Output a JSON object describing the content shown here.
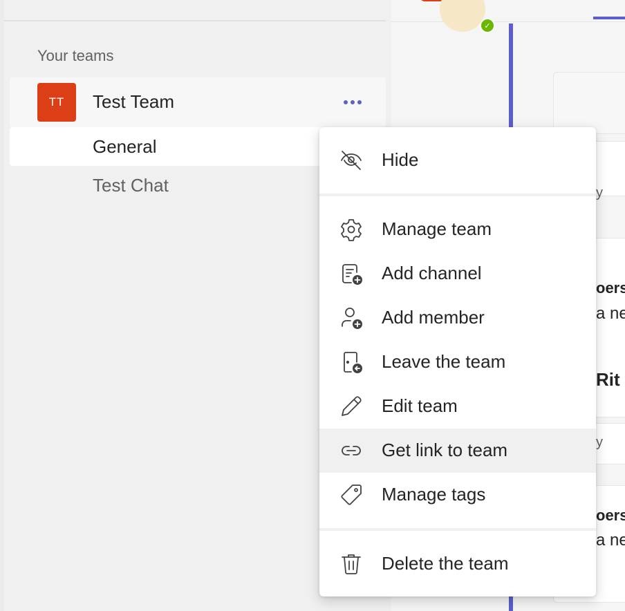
{
  "sidebar": {
    "section_label": "Your teams",
    "team": {
      "initials": "TT",
      "name": "Test Team",
      "avatar_color": "#dc3e15",
      "more_icon": "more-options-icon"
    },
    "channels": [
      {
        "label": "General",
        "selected": true
      },
      {
        "label": "Test Chat",
        "selected": false
      }
    ]
  },
  "main": {
    "peek_texts": [
      "oers",
      "a ne",
      "Rit",
      "oers",
      "a ne",
      "y",
      "y"
    ]
  },
  "menu": {
    "items": [
      {
        "label": "Hide",
        "icon": "eye-off-icon"
      },
      {
        "label": "Manage team",
        "icon": "gear-icon"
      },
      {
        "label": "Add channel",
        "icon": "add-channel-icon"
      },
      {
        "label": "Add member",
        "icon": "add-person-icon"
      },
      {
        "label": "Leave the team",
        "icon": "leave-door-icon"
      },
      {
        "label": "Edit team",
        "icon": "pencil-icon"
      },
      {
        "label": "Get link to team",
        "icon": "link-icon",
        "hovered": true
      },
      {
        "label": "Manage tags",
        "icon": "tag-icon"
      },
      {
        "label": "Delete the team",
        "icon": "trash-icon"
      }
    ]
  },
  "colors": {
    "accent": "#5b5fc7",
    "team_avatar": "#dc3e15",
    "presence": "#6bb700"
  }
}
